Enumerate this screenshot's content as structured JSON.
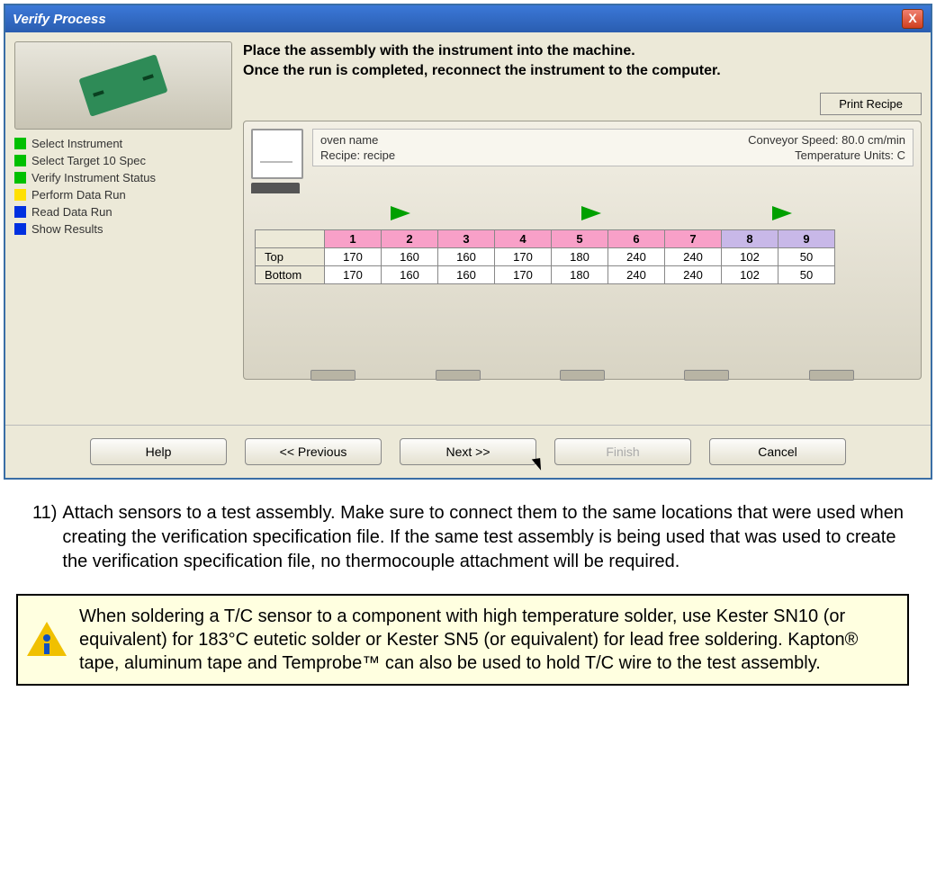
{
  "dialog": {
    "title": "Verify Process",
    "close_glyph": "X",
    "instruction_line1": "Place the assembly with the instrument into the machine.",
    "instruction_line2": "Once the run is completed, reconnect the instrument to the computer.",
    "steps": [
      {
        "color": "green",
        "label": "Select Instrument"
      },
      {
        "color": "green",
        "label": "Select Target 10 Spec"
      },
      {
        "color": "green",
        "label": "Verify Instrument Status"
      },
      {
        "color": "yellow",
        "label": "Perform Data Run"
      },
      {
        "color": "blue",
        "label": "Read Data Run"
      },
      {
        "color": "blue",
        "label": "Show Results"
      }
    ],
    "print_recipe": "Print Recipe",
    "oven_name_label": "oven name",
    "recipe_label": "Recipe:",
    "recipe_value": "recipe",
    "conveyor_label": "Conveyor Speed:",
    "conveyor_value": "80.0",
    "conveyor_units": "cm/min",
    "temp_units_label": "Temperature Units:",
    "temp_units_value": "C",
    "zone_headers": [
      "1",
      "2",
      "3",
      "4",
      "5",
      "6",
      "7",
      "8",
      "9"
    ],
    "zone_header_colors": [
      "pink",
      "pink",
      "pink",
      "pink",
      "pink",
      "pink",
      "pink",
      "lav",
      "lav"
    ],
    "row_top_label": "Top",
    "row_bottom_label": "Bottom",
    "row_top": [
      "170",
      "160",
      "160",
      "170",
      "180",
      "240",
      "240",
      "102",
      "50"
    ],
    "row_bottom": [
      "170",
      "160",
      "160",
      "170",
      "180",
      "240",
      "240",
      "102",
      "50"
    ],
    "buttons": {
      "help": "Help",
      "prev": "<< Previous",
      "next": "Next >>",
      "finish": "Finish",
      "cancel": "Cancel"
    }
  },
  "doc": {
    "item_number": "11)",
    "item_text": "Attach sensors to a test assembly. Make sure to connect them to the same locations that were used when creating the verification specification file. If the same test assembly is being used that was used to create the verification specification file, no thermocouple attachment will be required.",
    "info_text": "When soldering a T/C sensor to a component with high temperature solder, use Kester SN10 (or equivalent) for 183°C eutetic solder or Kester SN5 (or equivalent) for lead free soldering. Kapton® tape, aluminum tape and Temprobe™ can also be used to hold T/C wire to the test assembly."
  }
}
